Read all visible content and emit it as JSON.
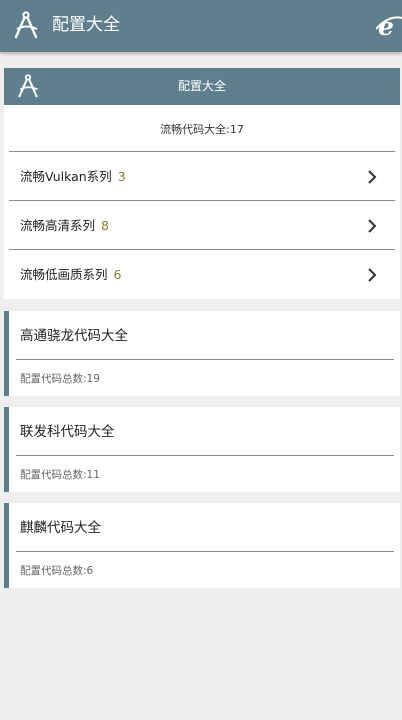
{
  "header": {
    "title": "配置大全",
    "logo_icon": "compass-logo-icon",
    "browser_icon": "ie-browser-icon"
  },
  "card": {
    "title": "配置大全",
    "total_label": "流畅代码大全",
    "total_value": "17",
    "rows": [
      {
        "label": "流畅Vulkan系列",
        "count": "3"
      },
      {
        "label": "流畅高清系列",
        "count": "8"
      },
      {
        "label": "流畅低画质系列",
        "count": "6"
      }
    ]
  },
  "vendors": [
    {
      "name": "高通骁龙代码大全",
      "count_label": "配置代码总数",
      "count": "19"
    },
    {
      "name": "联发科代码大全",
      "count_label": "配置代码总数",
      "count": "11"
    },
    {
      "name": "麒麟代码大全",
      "count_label": "配置代码总数",
      "count": "6"
    }
  ],
  "colors": {
    "primary": "#5f7f8f",
    "count_accent": "#8a7a2e",
    "background": "#efefef"
  }
}
